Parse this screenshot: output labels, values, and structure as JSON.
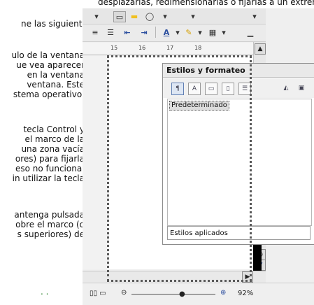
{
  "document": {
    "top_line": "desplazarlas, redimensionarlas o fijarlas a un extremo.",
    "left_lines": [
      "ne las siguientes",
      "ulo de la ventana",
      "ue vea aparecer",
      "en la ventana",
      "ventana. Este",
      "stema operativo,",
      "tecla Control y",
      "el marco de la",
      "una zona vacía",
      "ores) para fijarla",
      "eso no funciona,",
      "in utilizar la tecla",
      "antenga pulsada",
      "obre el marco (o",
      "s superiores) de"
    ],
    "bottom_mark": ". ."
  },
  "ruler": {
    "labels": [
      "15",
      "16",
      "17",
      "18"
    ]
  },
  "panel": {
    "title": "Estilos y formateo",
    "selected_style": "Predeterminado",
    "filter_value": "Estilos aplicados"
  },
  "statusbar": {
    "zoom": "92%"
  },
  "colors": {
    "accent": "#2c4f9f",
    "highlight": "#f0c020"
  }
}
